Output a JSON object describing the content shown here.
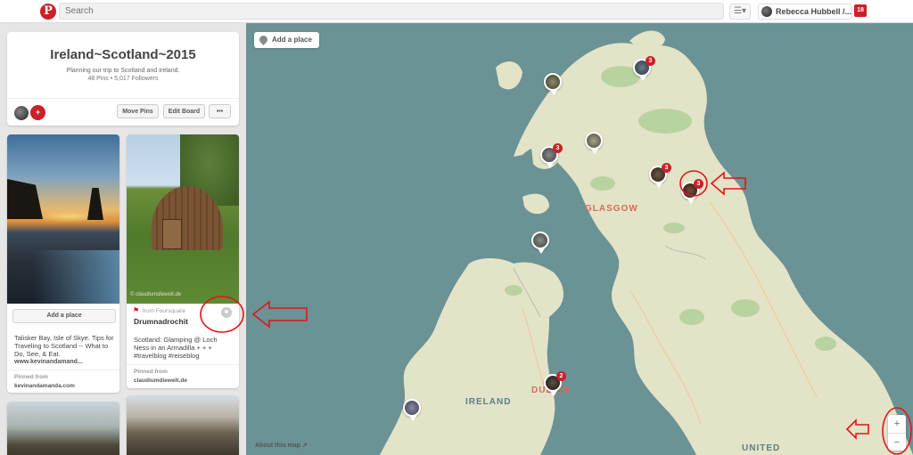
{
  "topbar": {
    "logo": "P",
    "search_placeholder": "Search",
    "user_name": "Rebecca Hubbell /...",
    "notification_count": "18"
  },
  "board": {
    "title": "Ireland~Scotland~2015",
    "description": "Planning our trip to Scotland and Ireland.",
    "stats": "48 Pins  •  5,017 Followers",
    "move_pins": "Move Pins",
    "edit_board": "Edit Board",
    "more": "•••",
    "add_collaborator": "+"
  },
  "pins": [
    {
      "add_place": "Add a place",
      "description": "Talisker Bay, Isle of Skye. Tips for Traveling to Scotland -- What to Do, See, & Eat.",
      "url": "www.kevinandamand...",
      "pinned_from_label": "Pinned from",
      "pinned_from": "kevinandamanda.com"
    },
    {
      "source_label": "from Foursquare",
      "place_name": "Drumnadrochit",
      "description": "Scotland: Glamping @ Loch Ness in an Armadilla + + + #travelblog #reiseblog",
      "pinned_from_label": "Pinned from",
      "pinned_from": "claudiumdiewelt.de",
      "watermark": "© claudiumdiewelt.de"
    }
  ],
  "map": {
    "add_place": "Add a place",
    "about": "About this map ↗",
    "zoom_in": "+",
    "zoom_out": "−",
    "labels": {
      "glasgow": "GLASGOW",
      "dublin": "DUBLIN",
      "ireland": "IRELAND",
      "united": "UNITED"
    },
    "markers": [
      {
        "badge": "3"
      },
      {
        "badge": ""
      },
      {
        "badge": "3"
      },
      {
        "badge": ""
      },
      {
        "badge": "3"
      },
      {
        "badge": "3"
      },
      {
        "badge": ""
      },
      {
        "badge": "2"
      },
      {
        "badge": ""
      }
    ]
  },
  "colors": {
    "brand": "#cb2027",
    "sea": "#6b9294",
    "land": "#e3e3c8",
    "annotation": "#e0161b"
  }
}
